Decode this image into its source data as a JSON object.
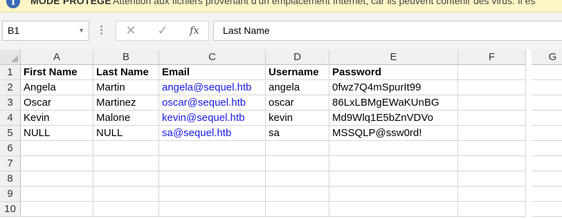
{
  "banner": {
    "icon": "info-icon",
    "title": "MODE PROTÉGÉ",
    "message": "Attention aux fichiers provenant d'un emplacement Internet, car ils peuvent contenir des virus. Il es"
  },
  "formula_bar": {
    "name_box": "B1",
    "formula": "Last Name",
    "cancel_icon": "✕",
    "enter_icon": "✓",
    "fx_label": "fx"
  },
  "columns": [
    "A",
    "B",
    "C",
    "D",
    "E",
    "F",
    "G"
  ],
  "rows": [
    "1",
    "2",
    "3",
    "4",
    "5",
    "6",
    "7",
    "8",
    "9",
    "10"
  ],
  "sheet": {
    "header": [
      "First Name",
      "Last Name",
      "Email",
      "Username",
      "Password"
    ],
    "records": [
      [
        "Angela",
        "Martin",
        "angela@sequel.htb",
        "angela",
        "0fwz7Q4mSpurIt99"
      ],
      [
        "Oscar",
        "Martinez",
        "oscar@sequel.htb",
        "oscar",
        "86LxLBMgEWaKUnBG"
      ],
      [
        "Kevin",
        "Malone",
        "kevin@sequel.htb",
        "kevin",
        "Md9Wlq1E5bZnVDVo"
      ],
      [
        "NULL",
        "NULL",
        "sa@sequel.htb",
        "sa",
        "MSSQLP@ssw0rd!"
      ]
    ]
  },
  "colors": {
    "banner_bg": "#fdf6c4",
    "link": "#1a1ae6",
    "header_bg": "#f0f0f0"
  }
}
